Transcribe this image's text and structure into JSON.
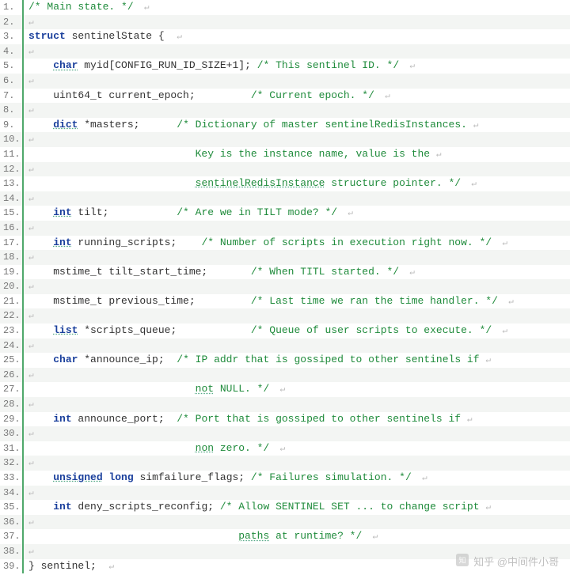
{
  "watermark_text": "知乎 @中间件小哥",
  "lines": [
    {
      "n": "1.",
      "segs": [
        {
          "t": "cm",
          "s": "/* Main state. */"
        },
        {
          "t": "nl",
          "s": "  ↵"
        }
      ]
    },
    {
      "n": "2.",
      "segs": [
        {
          "t": "nl",
          "s": "↵"
        }
      ]
    },
    {
      "n": "3.",
      "segs": [
        {
          "t": "kw",
          "s": "struct"
        },
        {
          "t": "pl",
          "s": " sentinelState {  "
        },
        {
          "t": "nl",
          "s": "↵"
        }
      ]
    },
    {
      "n": "4.",
      "segs": [
        {
          "t": "nl",
          "s": "↵"
        }
      ]
    },
    {
      "n": "5.",
      "segs": [
        {
          "t": "pl",
          "s": "    "
        },
        {
          "t": "ty",
          "s": "char"
        },
        {
          "t": "pl",
          "s": " myid[CONFIG_RUN_ID_SIZE+1]; "
        },
        {
          "t": "cm",
          "s": "/* This sentinel ID. */"
        },
        {
          "t": "nl",
          "s": "  ↵"
        }
      ]
    },
    {
      "n": "6.",
      "segs": [
        {
          "t": "nl",
          "s": "↵"
        }
      ]
    },
    {
      "n": "7.",
      "segs": [
        {
          "t": "pl",
          "s": "    uint64_t current_epoch;         "
        },
        {
          "t": "cm",
          "s": "/* Current epoch. */"
        },
        {
          "t": "nl",
          "s": "  ↵"
        }
      ]
    },
    {
      "n": "8.",
      "segs": [
        {
          "t": "nl",
          "s": "↵"
        }
      ]
    },
    {
      "n": "9.",
      "segs": [
        {
          "t": "pl",
          "s": "    "
        },
        {
          "t": "ty",
          "s": "dict"
        },
        {
          "t": "pl",
          "s": " *masters;      "
        },
        {
          "t": "cm",
          "s": "/* Dictionary of master sentinelRedisInstances. "
        },
        {
          "t": "nl",
          "s": "↵"
        }
      ]
    },
    {
      "n": "10.",
      "segs": [
        {
          "t": "nl",
          "s": "↵"
        }
      ]
    },
    {
      "n": "11.",
      "segs": [
        {
          "t": "cm",
          "s": "                           Key is the instance name, value is the "
        },
        {
          "t": "nl",
          "s": "↵"
        }
      ]
    },
    {
      "n": "12.",
      "segs": [
        {
          "t": "nl",
          "s": "↵"
        }
      ]
    },
    {
      "n": "13.",
      "segs": [
        {
          "t": "cm",
          "s": "                           "
        },
        {
          "t": "ul",
          "s": "sentinelRedisInstance"
        },
        {
          "t": "cm",
          "s": " structure pointer. */"
        },
        {
          "t": "nl",
          "s": "  ↵"
        }
      ]
    },
    {
      "n": "14.",
      "segs": [
        {
          "t": "nl",
          "s": "↵"
        }
      ]
    },
    {
      "n": "15.",
      "segs": [
        {
          "t": "pl",
          "s": "    "
        },
        {
          "t": "ty",
          "s": "int"
        },
        {
          "t": "pl",
          "s": " tilt;           "
        },
        {
          "t": "cm",
          "s": "/* Are we in TILT mode? */"
        },
        {
          "t": "nl",
          "s": "  ↵"
        }
      ]
    },
    {
      "n": "16.",
      "segs": [
        {
          "t": "nl",
          "s": "↵"
        }
      ]
    },
    {
      "n": "17.",
      "segs": [
        {
          "t": "pl",
          "s": "    "
        },
        {
          "t": "ty",
          "s": "int"
        },
        {
          "t": "pl",
          "s": " running_scripts;    "
        },
        {
          "t": "cm",
          "s": "/* Number of scripts in execution right now. */"
        },
        {
          "t": "nl",
          "s": "  ↵"
        }
      ]
    },
    {
      "n": "18.",
      "segs": [
        {
          "t": "nl",
          "s": "↵"
        }
      ]
    },
    {
      "n": "19.",
      "segs": [
        {
          "t": "pl",
          "s": "    mstime_t tilt_start_time;       "
        },
        {
          "t": "cm",
          "s": "/* When TITL started. */"
        },
        {
          "t": "nl",
          "s": "  ↵"
        }
      ]
    },
    {
      "n": "20.",
      "segs": [
        {
          "t": "nl",
          "s": "↵"
        }
      ]
    },
    {
      "n": "21.",
      "segs": [
        {
          "t": "pl",
          "s": "    mstime_t previous_time;         "
        },
        {
          "t": "cm",
          "s": "/* Last time we ran the time handler. */"
        },
        {
          "t": "nl",
          "s": "  ↵"
        }
      ]
    },
    {
      "n": "22.",
      "segs": [
        {
          "t": "nl",
          "s": "↵"
        }
      ]
    },
    {
      "n": "23.",
      "segs": [
        {
          "t": "pl",
          "s": "    "
        },
        {
          "t": "ty",
          "s": "list"
        },
        {
          "t": "pl",
          "s": " *scripts_queue;            "
        },
        {
          "t": "cm",
          "s": "/* Queue of user scripts to execute. */"
        },
        {
          "t": "nl",
          "s": "  ↵"
        }
      ]
    },
    {
      "n": "24.",
      "segs": [
        {
          "t": "nl",
          "s": "↵"
        }
      ]
    },
    {
      "n": "25.",
      "segs": [
        {
          "t": "pl",
          "s": "    "
        },
        {
          "t": "kw",
          "s": "char"
        },
        {
          "t": "pl",
          "s": " *announce_ip;  "
        },
        {
          "t": "cm",
          "s": "/* IP addr that is gossiped to other sentinels if "
        },
        {
          "t": "nl",
          "s": "↵"
        }
      ]
    },
    {
      "n": "26.",
      "segs": [
        {
          "t": "nl",
          "s": "↵"
        }
      ]
    },
    {
      "n": "27.",
      "segs": [
        {
          "t": "cm",
          "s": "                           "
        },
        {
          "t": "ul",
          "s": "not"
        },
        {
          "t": "cm",
          "s": " NULL. */"
        },
        {
          "t": "nl",
          "s": "  ↵"
        }
      ]
    },
    {
      "n": "28.",
      "segs": [
        {
          "t": "nl",
          "s": "↵"
        }
      ]
    },
    {
      "n": "29.",
      "segs": [
        {
          "t": "pl",
          "s": "    "
        },
        {
          "t": "kw",
          "s": "int"
        },
        {
          "t": "pl",
          "s": " announce_port;  "
        },
        {
          "t": "cm",
          "s": "/* Port that is gossiped to other sentinels if "
        },
        {
          "t": "nl",
          "s": "↵"
        }
      ]
    },
    {
      "n": "30.",
      "segs": [
        {
          "t": "nl",
          "s": "↵"
        }
      ]
    },
    {
      "n": "31.",
      "segs": [
        {
          "t": "cm",
          "s": "                           "
        },
        {
          "t": "ul",
          "s": "non"
        },
        {
          "t": "cm",
          "s": " zero. */"
        },
        {
          "t": "nl",
          "s": "  ↵"
        }
      ]
    },
    {
      "n": "32.",
      "segs": [
        {
          "t": "nl",
          "s": "↵"
        }
      ]
    },
    {
      "n": "33.",
      "segs": [
        {
          "t": "pl",
          "s": "    "
        },
        {
          "t": "ty",
          "s": "unsigned"
        },
        {
          "t": "pl",
          "s": " "
        },
        {
          "t": "kw",
          "s": "long"
        },
        {
          "t": "pl",
          "s": " simfailure_flags; "
        },
        {
          "t": "cm",
          "s": "/* Failures simulation. */"
        },
        {
          "t": "nl",
          "s": "  ↵"
        }
      ]
    },
    {
      "n": "34.",
      "segs": [
        {
          "t": "nl",
          "s": "↵"
        }
      ]
    },
    {
      "n": "35.",
      "segs": [
        {
          "t": "pl",
          "s": "    "
        },
        {
          "t": "kw",
          "s": "int"
        },
        {
          "t": "pl",
          "s": " deny_scripts_reconfig; "
        },
        {
          "t": "cm",
          "s": "/* Allow SENTINEL SET ... to change script "
        },
        {
          "t": "nl",
          "s": "↵"
        }
      ]
    },
    {
      "n": "36.",
      "segs": [
        {
          "t": "nl",
          "s": "↵"
        }
      ]
    },
    {
      "n": "37.",
      "segs": [
        {
          "t": "cm",
          "s": "                                  "
        },
        {
          "t": "ul",
          "s": "paths"
        },
        {
          "t": "cm",
          "s": " at runtime? */"
        },
        {
          "t": "nl",
          "s": "  ↵"
        }
      ]
    },
    {
      "n": "38.",
      "segs": [
        {
          "t": "nl",
          "s": "↵"
        }
      ]
    },
    {
      "n": "39.",
      "segs": [
        {
          "t": "pl",
          "s": "} sentinel;  "
        },
        {
          "t": "nl",
          "s": "↵"
        }
      ]
    }
  ]
}
